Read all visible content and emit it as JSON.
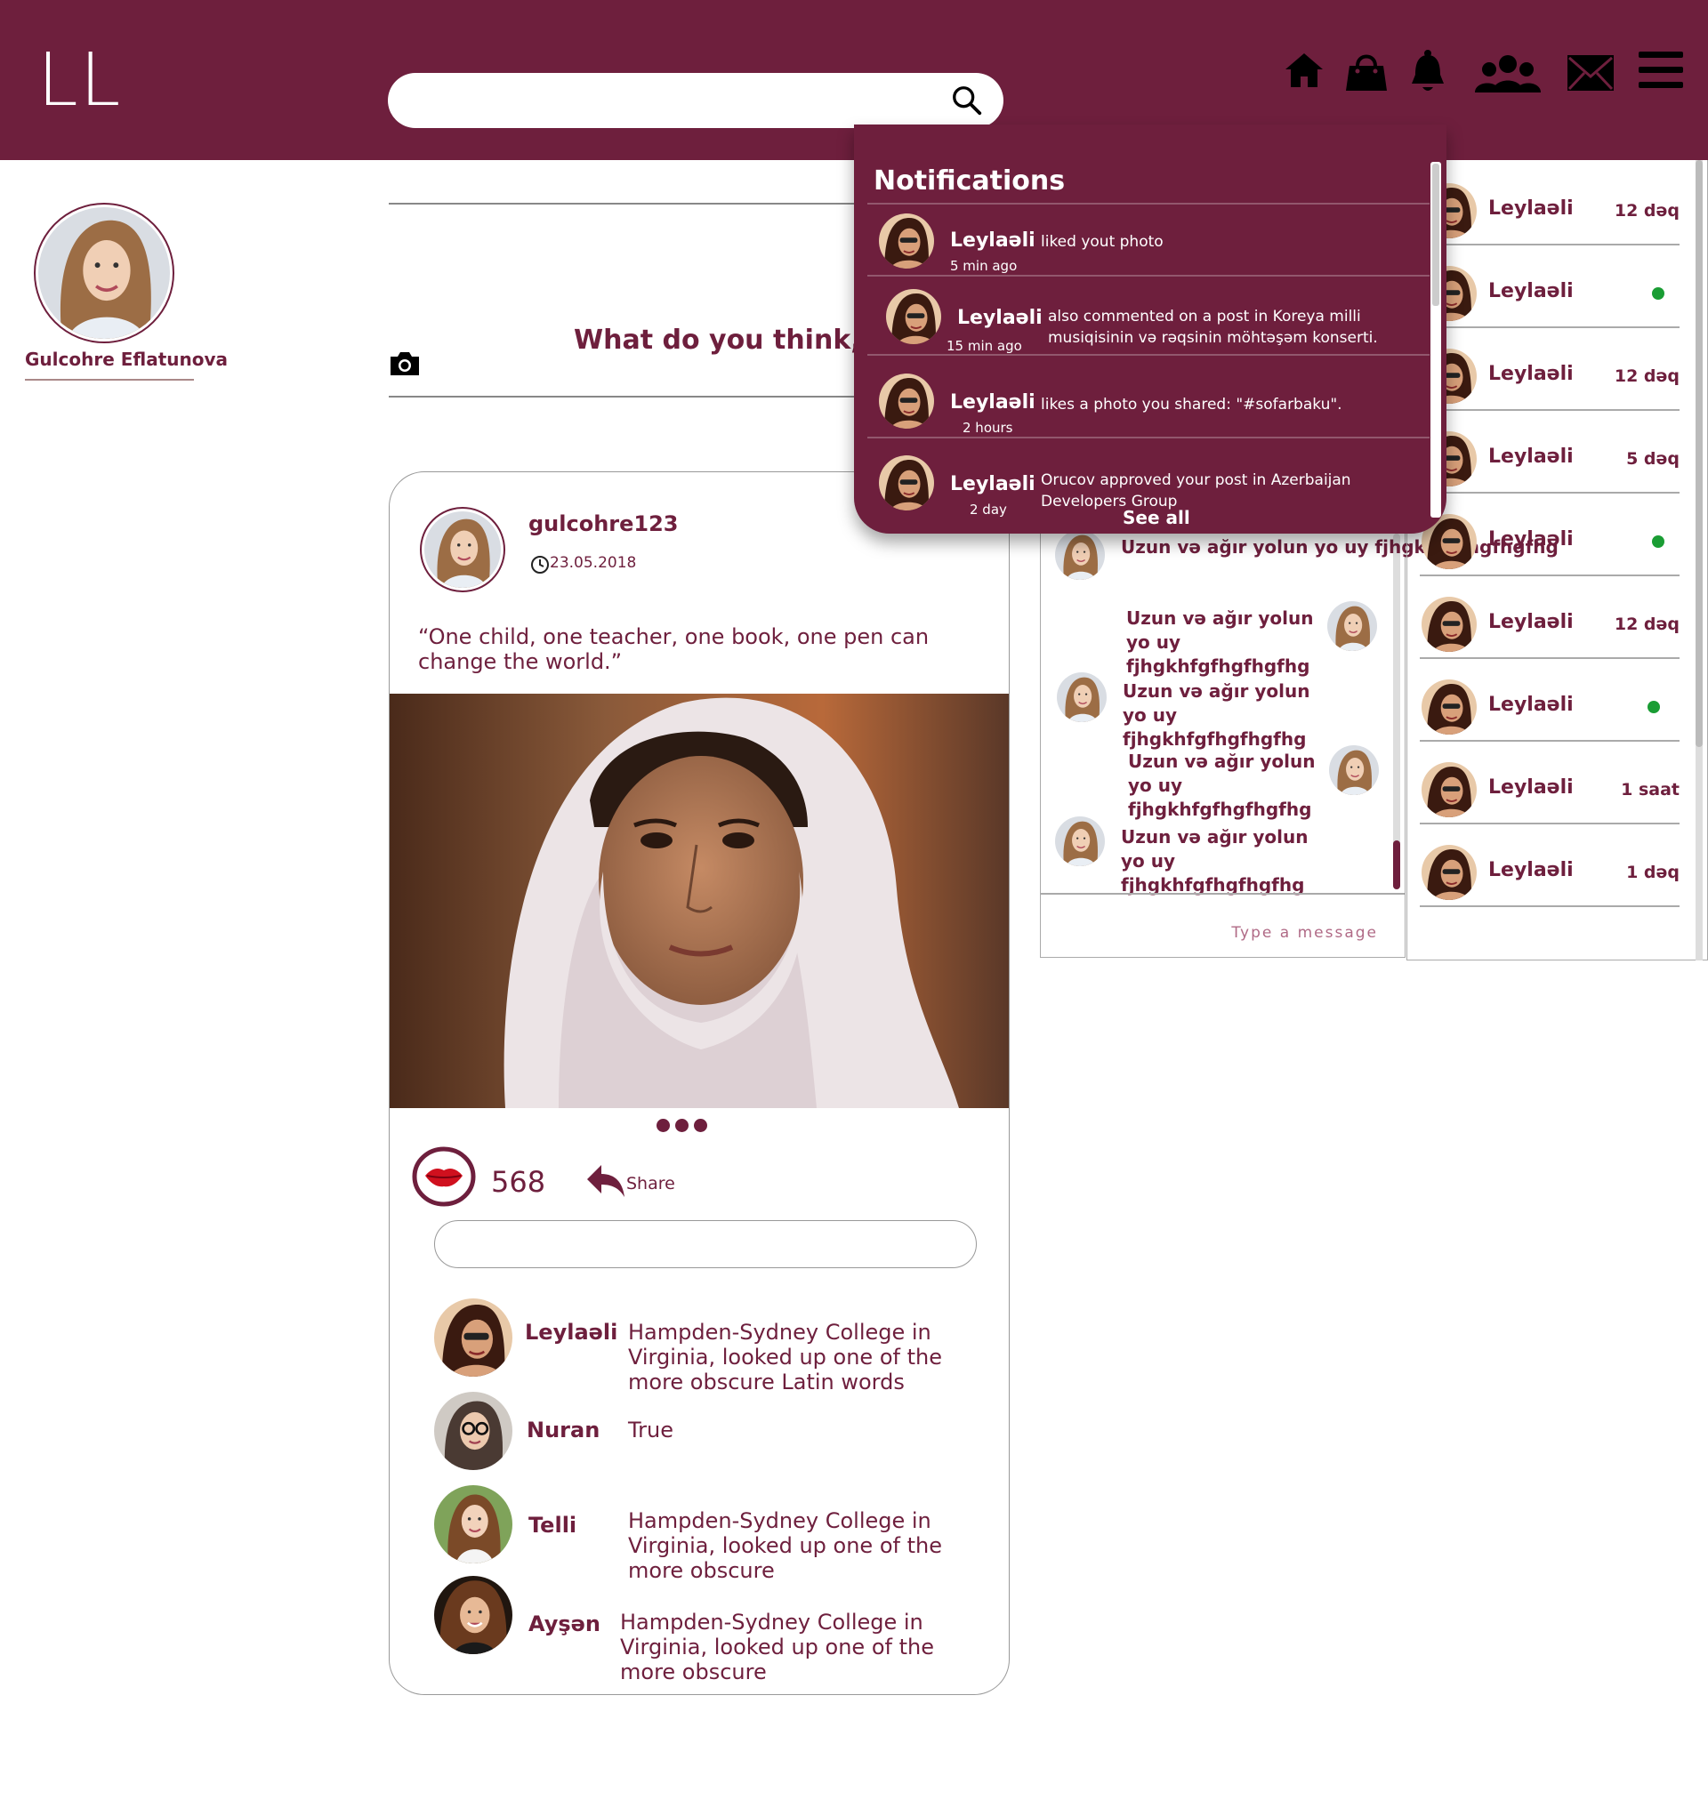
{
  "header": {
    "logo": "LL",
    "search": {
      "value": "",
      "placeholder": ""
    },
    "icons": [
      "home-icon",
      "shopping-bag-icon",
      "bell-icon",
      "friends-icon",
      "mail-icon",
      "menu-icon"
    ]
  },
  "profile": {
    "name": "Gulcohre Eflatunova"
  },
  "composer": {
    "prompt": "What do you think, Gu"
  },
  "post": {
    "username": "gulcohre123",
    "date": "23.05.2018",
    "quote": "“One child, one teacher, one book, one pen can change the world.”",
    "likes": "568",
    "share_label": "Share",
    "comment_value": "",
    "comments": [
      {
        "name": "Leylaəli",
        "text": "Hampden-Sydney College in Virginia, looked up one of the more obscure Latin words"
      },
      {
        "name": "Nuran",
        "text": "True"
      },
      {
        "name": "Telli",
        "text": "Hampden-Sydney College in Virginia, looked up one of the more obscure"
      },
      {
        "name": "Ayşən",
        "text": "Hampden-Sydney College in Virginia, looked up one of the more obscure"
      }
    ]
  },
  "notifications": {
    "title": "Notifications",
    "see_all": "See all",
    "items": [
      {
        "name": "Leylaəli",
        "time": "5 min ago",
        "text": "liked yout photo"
      },
      {
        "name": "Leylaəli",
        "time": "15 min ago",
        "text": "also commented on a post in Koreya milli musiqisinin və rəqsinin möhtəşəm konserti."
      },
      {
        "name": "Leylaəli",
        "time": "2 hours",
        "text": "likes a photo you shared: \"#sofarbaku\"."
      },
      {
        "name": "Leylaəli",
        "time": "2 day",
        "text": "Orucov approved your post in Azerbaijan Developers Group"
      }
    ]
  },
  "chat": {
    "messages": [
      {
        "text": "Uzun və ağır yolun yo uy fjhgkhfgfhgfhgfhg",
        "side": "left"
      },
      {
        "text": "Uzun və ağır yolun yo uy fjhgkhfgfhgfhgfhg",
        "side": "right"
      },
      {
        "text": "Uzun və ağır yolun yo uy fjhgkhfgfhgfhgfhg",
        "side": "left"
      },
      {
        "text": "Uzun və ağır yolun yo uy fjhgkhfgfhgfhgfhg",
        "side": "right"
      },
      {
        "text": "Uzun və ağır yolun yo uy fjhgkhfgfhgfhgfhg",
        "side": "left"
      }
    ],
    "placeholder": "Type  a  message"
  },
  "contacts": [
    {
      "name": "Leylaəli",
      "status": "12 dəq"
    },
    {
      "name": "Leylaəli",
      "status": "online"
    },
    {
      "name": "Leylaəli",
      "status": "12 dəq"
    },
    {
      "name": "Leylaəli",
      "status": "5 dəq"
    },
    {
      "name": "Leylaəli",
      "status": "online"
    },
    {
      "name": "Leylaəli",
      "status": "12 dəq"
    },
    {
      "name": "Leylaəli",
      "status": "online"
    },
    {
      "name": "Leylaəli",
      "status": "1 saat"
    },
    {
      "name": "Leylaəli",
      "status": "1 dəq"
    }
  ],
  "colors": {
    "brand": "#6e1f3d",
    "online": "#1a9d34"
  }
}
